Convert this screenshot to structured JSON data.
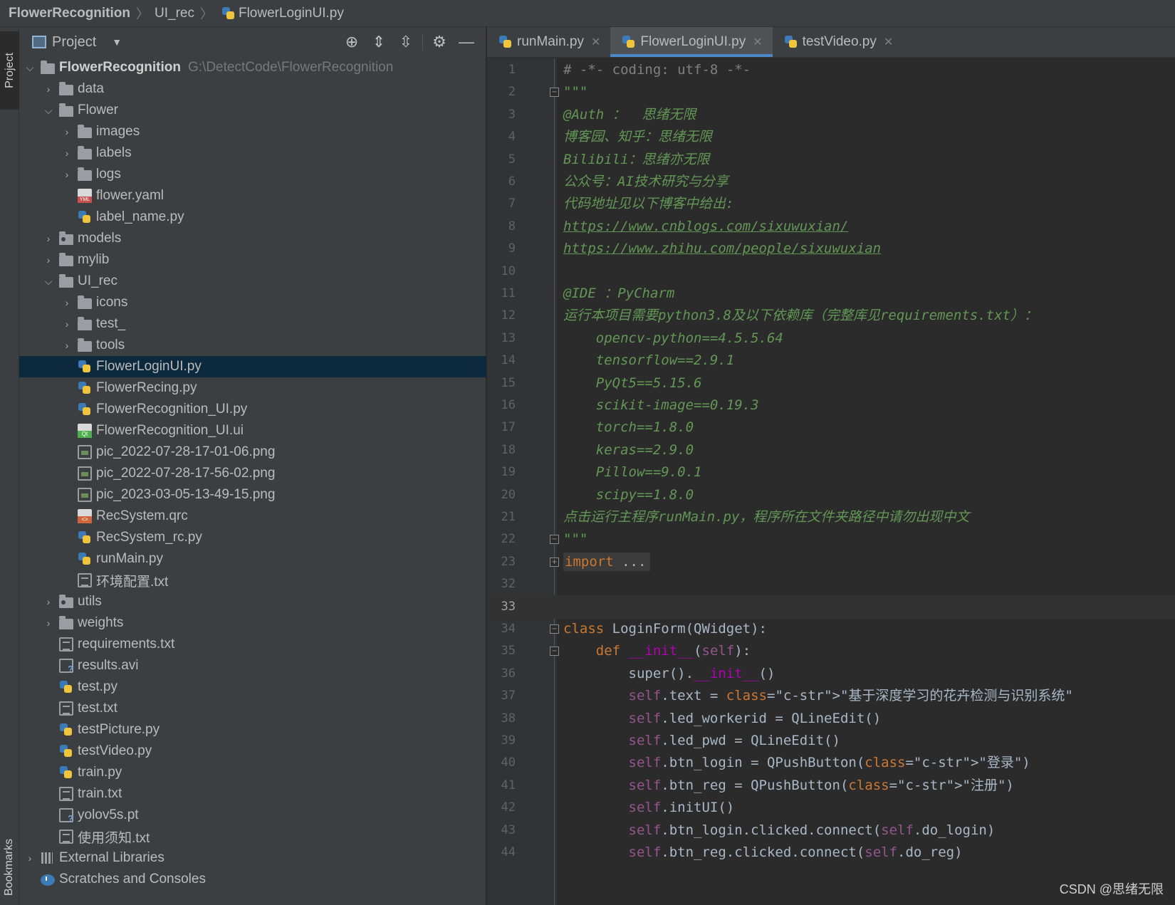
{
  "breadcrumb": {
    "root": "FlowerRecognition",
    "folder": "UI_rec",
    "file": "FlowerLoginUI.py"
  },
  "left_strip": {
    "project_tab": "Project",
    "bookmarks_tab": "Bookmarks"
  },
  "project_panel": {
    "title": "Project",
    "tools": [
      "target-icon",
      "expand-all-icon",
      "collapse-all-icon",
      "gear-icon",
      "minimize-icon"
    ]
  },
  "tree": [
    {
      "label": "FlowerRecognition",
      "path": "G:\\DetectCode\\FlowerRecognition"
    },
    {
      "label": "data"
    },
    {
      "label": "Flower"
    },
    {
      "label": "images"
    },
    {
      "label": "labels"
    },
    {
      "label": "logs"
    },
    {
      "label": "flower.yaml"
    },
    {
      "label": "label_name.py"
    },
    {
      "label": "models"
    },
    {
      "label": "mylib"
    },
    {
      "label": "UI_rec"
    },
    {
      "label": "icons"
    },
    {
      "label": "test_"
    },
    {
      "label": "tools"
    },
    {
      "label": "FlowerLoginUI.py"
    },
    {
      "label": "FlowerRecing.py"
    },
    {
      "label": "FlowerRecognition_UI.py"
    },
    {
      "label": "FlowerRecognition_UI.ui"
    },
    {
      "label": "pic_2022-07-28-17-01-06.png"
    },
    {
      "label": "pic_2022-07-28-17-56-02.png"
    },
    {
      "label": "pic_2023-03-05-13-49-15.png"
    },
    {
      "label": "RecSystem.qrc"
    },
    {
      "label": "RecSystem_rc.py"
    },
    {
      "label": "runMain.py"
    },
    {
      "label": "环境配置.txt"
    },
    {
      "label": "utils"
    },
    {
      "label": "weights"
    },
    {
      "label": "requirements.txt"
    },
    {
      "label": "results.avi"
    },
    {
      "label": "test.py"
    },
    {
      "label": "test.txt"
    },
    {
      "label": "testPicture.py"
    },
    {
      "label": "testVideo.py"
    },
    {
      "label": "train.py"
    },
    {
      "label": "train.txt"
    },
    {
      "label": "yolov5s.pt"
    },
    {
      "label": "使用须知.txt"
    },
    {
      "label": "External Libraries"
    },
    {
      "label": "Scratches and Consoles"
    }
  ],
  "tabs": [
    {
      "label": "runMain.py",
      "active": false
    },
    {
      "label": "FlowerLoginUI.py",
      "active": true
    },
    {
      "label": "testVideo.py",
      "active": false
    }
  ],
  "editor": {
    "current_line": "33",
    "lines": [
      {
        "n": "1",
        "t": "# -*- coding: utf-8 -*-"
      },
      {
        "n": "2",
        "t": "\"\"\""
      },
      {
        "n": "3",
        "t": "@Auth ：  思绪无限"
      },
      {
        "n": "4",
        "t": "博客园、知乎：思绪无限"
      },
      {
        "n": "5",
        "t": "Bilibili：思绪亦无限"
      },
      {
        "n": "6",
        "t": "公众号：AI技术研究与分享"
      },
      {
        "n": "7",
        "t": "代码地址见以下博客中给出:"
      },
      {
        "n": "8",
        "t": "https://www.cnblogs.com/sixuwuxian/"
      },
      {
        "n": "9",
        "t": "https://www.zhihu.com/people/sixuwuxian"
      },
      {
        "n": "10",
        "t": ""
      },
      {
        "n": "11",
        "t": "@IDE ：PyCharm"
      },
      {
        "n": "12",
        "t": "运行本项目需要python3.8及以下依赖库（完整库见requirements.txt）："
      },
      {
        "n": "13",
        "t": "    opencv-python==4.5.5.64"
      },
      {
        "n": "14",
        "t": "    tensorflow==2.9.1"
      },
      {
        "n": "15",
        "t": "    PyQt5==5.15.6"
      },
      {
        "n": "16",
        "t": "    scikit-image==0.19.3"
      },
      {
        "n": "17",
        "t": "    torch==1.8.0"
      },
      {
        "n": "18",
        "t": "    keras==2.9.0"
      },
      {
        "n": "19",
        "t": "    Pillow==9.0.1"
      },
      {
        "n": "20",
        "t": "    scipy==1.8.0"
      },
      {
        "n": "21",
        "t": "点击运行主程序runMain.py，程序所在文件夹路径中请勿出现中文"
      },
      {
        "n": "22",
        "t": "\"\"\""
      },
      {
        "n": "23",
        "t": "import ..."
      },
      {
        "n": "32",
        "t": ""
      },
      {
        "n": "33",
        "t": ""
      },
      {
        "n": "34",
        "t": "class LoginForm(QWidget):"
      },
      {
        "n": "35",
        "t": "    def __init__(self):"
      },
      {
        "n": "36",
        "t": "        super().__init__()"
      },
      {
        "n": "37",
        "t": "        self.text = \"基于深度学习的花卉检测与识别系统\""
      },
      {
        "n": "38",
        "t": "        self.led_workerid = QLineEdit()"
      },
      {
        "n": "39",
        "t": "        self.led_pwd = QLineEdit()"
      },
      {
        "n": "40",
        "t": "        self.btn_login = QPushButton(\"登录\")"
      },
      {
        "n": "41",
        "t": "        self.btn_reg = QPushButton(\"注册\")"
      },
      {
        "n": "42",
        "t": "        self.initUI()"
      },
      {
        "n": "43",
        "t": "        self.btn_login.clicked.connect(self.do_login)"
      },
      {
        "n": "44",
        "t": "        self.btn_reg.clicked.connect(self.do_reg)"
      }
    ]
  },
  "watermark": "CSDN @思绪无限",
  "colors": {
    "accent": "#4a88c7",
    "selection": "#0d293e",
    "docstring": "#629755",
    "keyword": "#cc7832",
    "self": "#94558d",
    "string": "#6a8759"
  }
}
